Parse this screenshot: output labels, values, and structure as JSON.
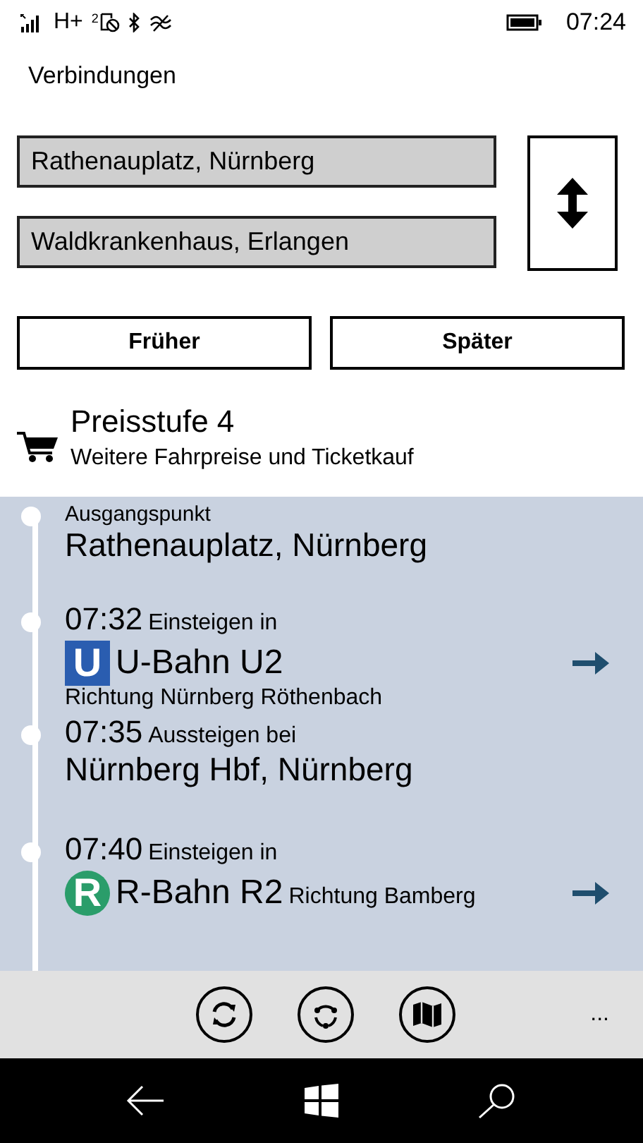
{
  "status_bar": {
    "network": "H+",
    "sim": "2",
    "time": "07:24"
  },
  "page_title": "Verbindungen",
  "route": {
    "from": "Rathenauplatz, Nürnberg",
    "to": "Waldkrankenhaus, Erlangen"
  },
  "time_buttons": [
    "Früher",
    "Später"
  ],
  "fare": {
    "title": "Preisstufe 4",
    "subtitle": "Weitere Fahrpreise und Ticketkauf"
  },
  "steps": [
    {
      "kind": "origin",
      "label": "Ausgangspunkt",
      "place": "Rathenauplatz, Nürnberg"
    },
    {
      "kind": "board",
      "time": "07:32",
      "action": "Einsteigen in",
      "badge": {
        "letter": "U",
        "kind": "square",
        "color": "#2a5db0"
      },
      "line": "U-Bahn U2",
      "direction": "Richtung Nürnberg Röthenbach"
    },
    {
      "kind": "alight",
      "time": "07:35",
      "action": "Aussteigen bei",
      "place": "Nürnberg Hbf, Nürnberg"
    },
    {
      "kind": "board_inline",
      "time": "07:40",
      "action": "Einsteigen in",
      "badge": {
        "letter": "R",
        "kind": "circle",
        "color": "#2a9d6a"
      },
      "line": "R-Bahn R2",
      "direction": "Richtung Bamberg"
    }
  ],
  "app_bar": {
    "more": "..."
  }
}
